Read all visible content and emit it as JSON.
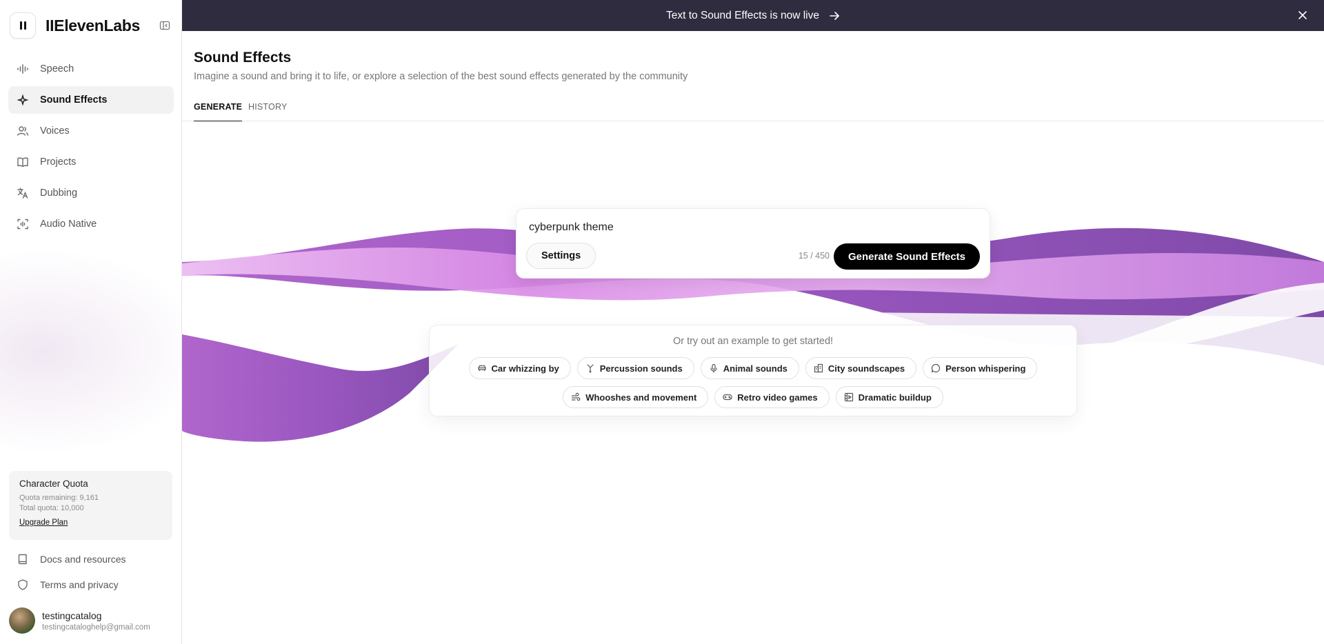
{
  "app": {
    "brand": "IIElevenLabs"
  },
  "sidebar": {
    "items": [
      {
        "label": "Speech",
        "icon": "waveform-icon"
      },
      {
        "label": "Sound Effects",
        "icon": "sparkle-icon"
      },
      {
        "label": "Voices",
        "icon": "users-icon"
      },
      {
        "label": "Projects",
        "icon": "book-open-icon"
      },
      {
        "label": "Dubbing",
        "icon": "translate-icon"
      },
      {
        "label": "Audio Native",
        "icon": "audio-frame-icon"
      }
    ],
    "active": "Sound Effects",
    "quota": {
      "title": "Character Quota",
      "remaining": "Quota remaining: 9,161",
      "total": "Total quota: 10,000",
      "upgrade": "Upgrade Plan"
    },
    "bottom_links": [
      {
        "label": "Docs and resources",
        "icon": "book-icon"
      },
      {
        "label": "Terms and privacy",
        "icon": "shield-icon"
      }
    ],
    "user": {
      "name": "testingcatalog",
      "email": "testingcataloghelp@gmail.com"
    }
  },
  "banner": {
    "text": "Text to Sound Effects is now live"
  },
  "header": {
    "title": "Sound Effects",
    "subtitle": "Imagine a sound and bring it to life, or explore a selection of the best sound effects generated by the community"
  },
  "tabs": [
    {
      "label": "GENERATE"
    },
    {
      "label": "HISTORY"
    }
  ],
  "prompt": {
    "value": "cyberpunk theme",
    "settings_label": "Settings",
    "char_count": "15 / 450",
    "generate_label": "Generate Sound Effects"
  },
  "examples": {
    "title": "Or try out an example to get started!",
    "row1": [
      {
        "label": "Car whizzing by",
        "icon": "car-icon"
      },
      {
        "label": "Percussion sounds",
        "icon": "drum-icon"
      },
      {
        "label": "Animal sounds",
        "icon": "microphone-icon"
      },
      {
        "label": "City soundscapes",
        "icon": "building-icon"
      },
      {
        "label": "Person whispering",
        "icon": "speech-bubble-icon"
      }
    ],
    "row2": [
      {
        "label": "Whooshes and movement",
        "icon": "wind-icon"
      },
      {
        "label": "Retro video games",
        "icon": "gamepad-icon"
      },
      {
        "label": "Dramatic buildup",
        "icon": "film-icon"
      }
    ]
  },
  "colors": {
    "banner": "#2f2c3f",
    "wave_dark": "#8a4fb3",
    "wave_light": "#e6a3f0",
    "accent": "#000000"
  }
}
